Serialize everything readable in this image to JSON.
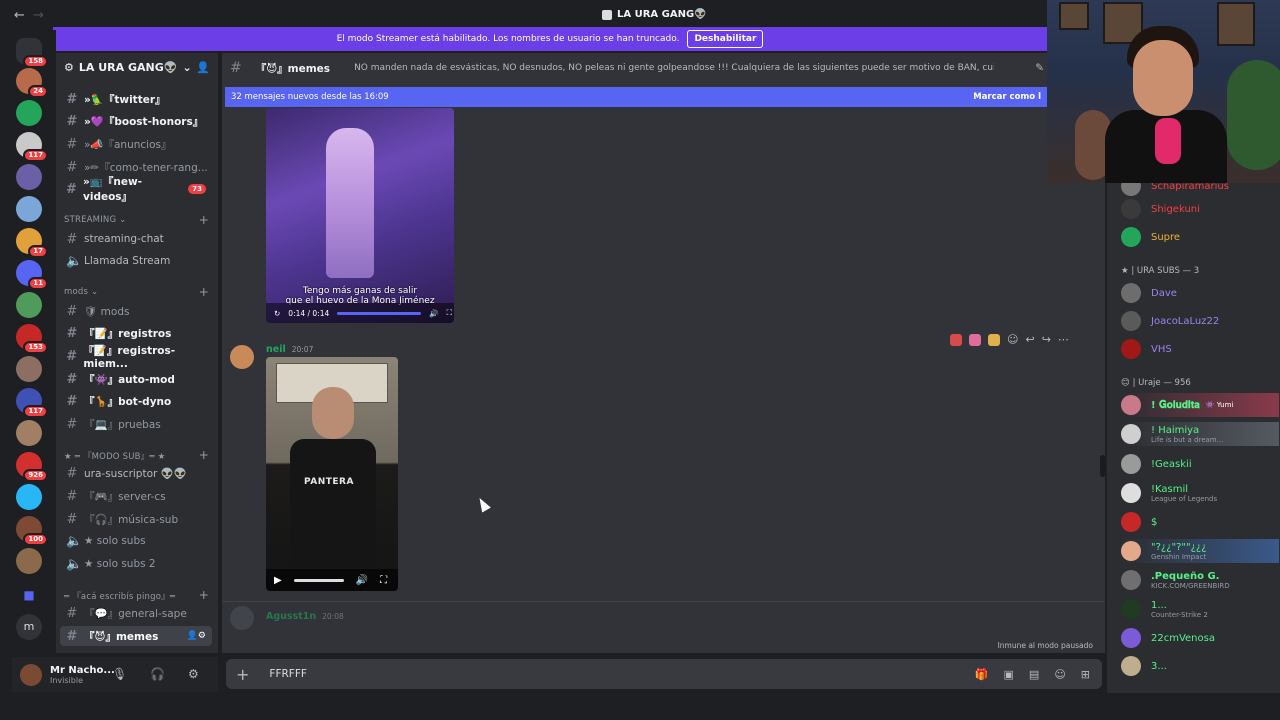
{
  "window": {
    "title": "LA URA GANG👽",
    "back": "←",
    "forward": "→"
  },
  "banner": {
    "text": "El modo Streamer está habilitado. Los nombres de usuario se han truncado.",
    "button": "Deshabilitar"
  },
  "rail": {
    "badges": [
      "158",
      "24",
      "117",
      "17",
      "11",
      "153",
      "117",
      "926",
      "100"
    ],
    "bottom_letter": "m"
  },
  "server": {
    "name": "LA URA GANG👽"
  },
  "channels": [
    {
      "label": "»🦜『twitter』",
      "bright": true
    },
    {
      "label": "»💜『boost-honors』",
      "bright": true
    },
    {
      "label": "»📣『anuncios』",
      "bright": false
    },
    {
      "label": "»✏『como-tener-rang...",
      "bright": false
    },
    {
      "label": "»📺『new-videos』",
      "bright": true,
      "count": "73"
    }
  ],
  "categories": {
    "streaming": "STREAMING",
    "mods": "mods",
    "modo_sub": "★ ═ 『MODO SUB』═ ★",
    "escribis": "═ 『acá escribís pingo』═"
  },
  "streaming_channels": [
    "streaming-chat",
    "Llamada Stream"
  ],
  "mod_channels": [
    "🛡 mods",
    "『📝』registros",
    "『📝』registros-miem...",
    "『👾』auto-mod",
    "『🦒』bot-dyno",
    "『💻』pruebas"
  ],
  "sub_channels": [
    "ura-suscriptor 👽👽",
    "『🎮』server-cs",
    "『🎧』música-sub",
    "★ solo subs",
    "★ solo subs 2"
  ],
  "write_channels": [
    "『💬』general-sape",
    "『😈』memes"
  ],
  "user": {
    "name": "Mr Nacho...",
    "status": "Invisible"
  },
  "chat": {
    "channel": "『😈』memes",
    "topic": "NO manden nada de esvásticas, NO desnudos, NO peleas ni gente golpeandose !!! Cualquiera de las siguientes puede ser motivo de BAN, cuiden el stream!",
    "new_messages": "32 mensajes nuevos desde las 16:09",
    "mark_read": "Marcar como l",
    "video1": {
      "caption_line1": "Tengo más ganas de salir",
      "caption_line2": "que el huevo de la Mona Jiménez",
      "time": "0:14 / 0:14"
    },
    "msg2": {
      "author": "neil",
      "time": "20:07",
      "shirt_text": "PANTERA"
    },
    "msg3": {
      "author": "Agusst1n",
      "time": "20:08"
    },
    "paused": "Inmune al modo pausado"
  },
  "composer": {
    "text": "FFRFFF"
  },
  "members": {
    "top": [
      {
        "name": "Schapiramarius",
        "color": "#f23f43"
      },
      {
        "name": "Shigekuni",
        "color": "#f23f43"
      },
      {
        "name": "Supre",
        "color": "#f0b232"
      }
    ],
    "role_subs": "★ | URA SUBS — 3",
    "subs": [
      {
        "name": "Dave",
        "color": "#9b84ec"
      },
      {
        "name": "JoacoLaLuz22",
        "color": "#9b84ec"
      },
      {
        "name": "VHS",
        "color": "#9b84ec"
      }
    ],
    "role_uraje": "😊 | Uraje — 956",
    "uraje": [
      {
        "name": "! 𝐆𝐨𝐥𝐮𝐝𝐢𝐭𝐚",
        "sub": "👾 Yumi",
        "color": "#57f287"
      },
      {
        "name": "! Haimiya",
        "sub": "Life is but a dream...",
        "color": "#57f287"
      },
      {
        "name": "!Geaskii",
        "sub": "",
        "color": "#57f287"
      },
      {
        "name": "!Kasmil",
        "sub": "League of Legends",
        "color": "#57f287"
      },
      {
        "name": "$",
        "sub": "",
        "color": "#57f287"
      },
      {
        "name": "\"?¿¿\"?\"\"¿¿¿",
        "sub": "Genshin Impact",
        "color": "#57f287"
      },
      {
        "name": ".Pequeño G.",
        "sub": "KICK.COM/GREENBIRD",
        "color": "#57f287"
      },
      {
        "name": "1...",
        "sub": "Counter-Strike 2",
        "color": "#57f287"
      },
      {
        "name": "22cmVenosa",
        "sub": "",
        "color": "#57f287"
      },
      {
        "name": "3...",
        "sub": "",
        "color": "#57f287"
      }
    ]
  }
}
